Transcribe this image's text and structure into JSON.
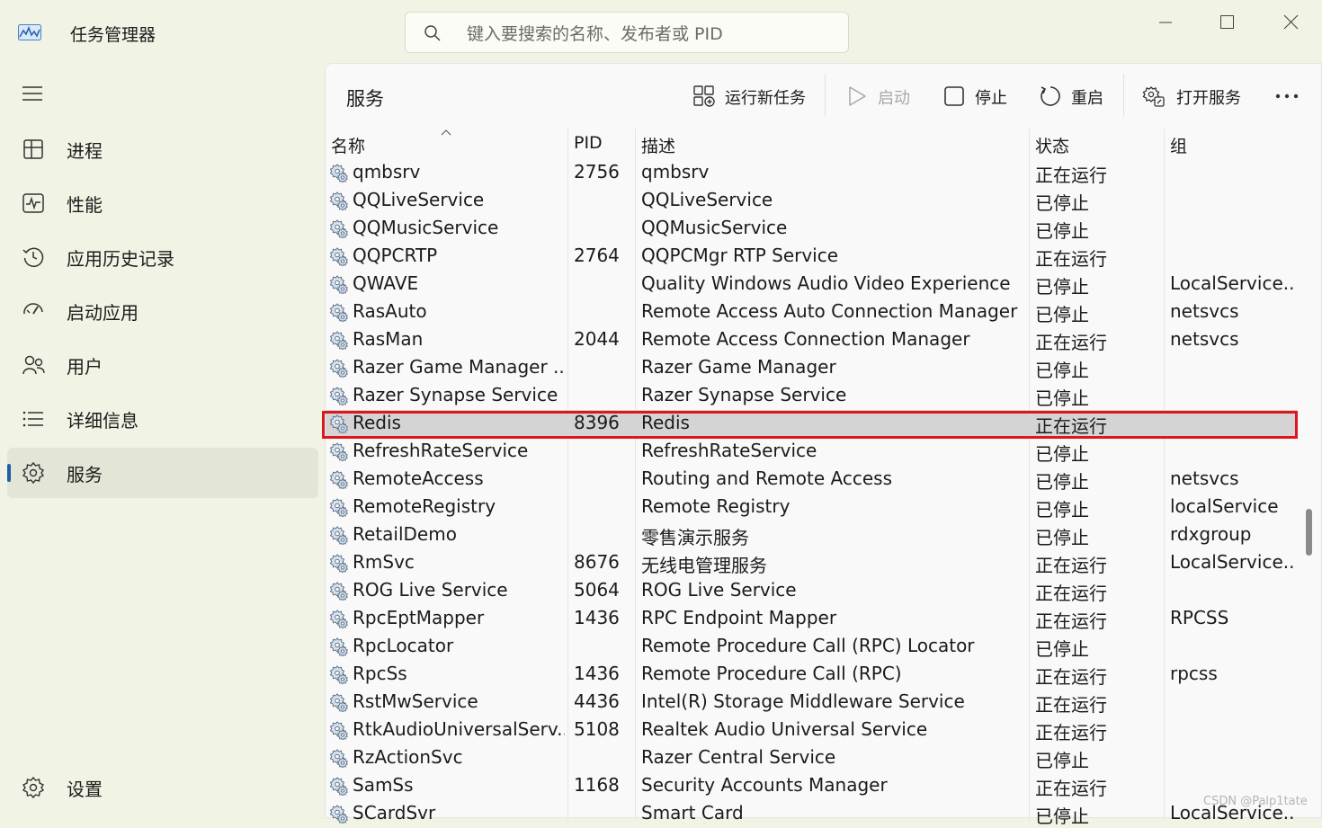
{
  "titlebar": {
    "app_title": "任务管理器",
    "search_placeholder": "键入要搜索的名称、发布者或 PID"
  },
  "sidebar": {
    "items": [
      {
        "label": "进程",
        "icon": "processes-icon"
      },
      {
        "label": "性能",
        "icon": "performance-icon"
      },
      {
        "label": "应用历史记录",
        "icon": "history-icon"
      },
      {
        "label": "启动应用",
        "icon": "startup-icon"
      },
      {
        "label": "用户",
        "icon": "users-icon"
      },
      {
        "label": "详细信息",
        "icon": "details-icon"
      },
      {
        "label": "服务",
        "icon": "services-icon",
        "active": true
      }
    ],
    "settings_label": "设置"
  },
  "toolbar": {
    "page_title": "服务",
    "run_new_task": "运行新任务",
    "start": "启动",
    "stop": "停止",
    "restart": "重启",
    "open_services": "打开服务",
    "more": "..."
  },
  "table": {
    "columns": [
      "名称",
      "PID",
      "描述",
      "状态",
      "组"
    ],
    "rows": [
      {
        "name": "qmbsrv",
        "pid": "2756",
        "desc": "qmbsrv",
        "status": "正在运行",
        "group": ""
      },
      {
        "name": "QQLiveService",
        "pid": "",
        "desc": "QQLiveService",
        "status": "已停止",
        "group": ""
      },
      {
        "name": "QQMusicService",
        "pid": "",
        "desc": "QQMusicService",
        "status": "已停止",
        "group": ""
      },
      {
        "name": "QQPCRTP",
        "pid": "2764",
        "desc": "QQPCMgr RTP Service",
        "status": "正在运行",
        "group": ""
      },
      {
        "name": "QWAVE",
        "pid": "",
        "desc": "Quality Windows Audio Video Experience",
        "status": "已停止",
        "group": "LocalService..."
      },
      {
        "name": "RasAuto",
        "pid": "",
        "desc": "Remote Access Auto Connection Manager",
        "status": "已停止",
        "group": "netsvcs"
      },
      {
        "name": "RasMan",
        "pid": "2044",
        "desc": "Remote Access Connection Manager",
        "status": "正在运行",
        "group": "netsvcs"
      },
      {
        "name": "Razer Game Manager ...",
        "pid": "",
        "desc": "Razer Game Manager",
        "status": "已停止",
        "group": ""
      },
      {
        "name": "Razer Synapse Service",
        "pid": "",
        "desc": "Razer Synapse Service",
        "status": "已停止",
        "group": ""
      },
      {
        "name": "Redis",
        "pid": "8396",
        "desc": "Redis",
        "status": "正在运行",
        "group": "",
        "selected": true
      },
      {
        "name": "RefreshRateService",
        "pid": "",
        "desc": "RefreshRateService",
        "status": "已停止",
        "group": ""
      },
      {
        "name": "RemoteAccess",
        "pid": "",
        "desc": "Routing and Remote Access",
        "status": "已停止",
        "group": "netsvcs"
      },
      {
        "name": "RemoteRegistry",
        "pid": "",
        "desc": "Remote Registry",
        "status": "已停止",
        "group": "localService"
      },
      {
        "name": "RetailDemo",
        "pid": "",
        "desc": "零售演示服务",
        "status": "已停止",
        "group": "rdxgroup"
      },
      {
        "name": "RmSvc",
        "pid": "8676",
        "desc": "无线电管理服务",
        "status": "正在运行",
        "group": "LocalService..."
      },
      {
        "name": "ROG Live Service",
        "pid": "5064",
        "desc": "ROG Live Service",
        "status": "正在运行",
        "group": ""
      },
      {
        "name": "RpcEptMapper",
        "pid": "1436",
        "desc": "RPC Endpoint Mapper",
        "status": "正在运行",
        "group": "RPCSS"
      },
      {
        "name": "RpcLocator",
        "pid": "",
        "desc": "Remote Procedure Call (RPC) Locator",
        "status": "已停止",
        "group": ""
      },
      {
        "name": "RpcSs",
        "pid": "1436",
        "desc": "Remote Procedure Call (RPC)",
        "status": "正在运行",
        "group": "rpcss"
      },
      {
        "name": "RstMwService",
        "pid": "4436",
        "desc": "Intel(R) Storage Middleware Service",
        "status": "正在运行",
        "group": ""
      },
      {
        "name": "RtkAudioUniversalServ...",
        "pid": "5108",
        "desc": "Realtek Audio Universal Service",
        "status": "正在运行",
        "group": ""
      },
      {
        "name": "RzActionSvc",
        "pid": "",
        "desc": "Razer Central Service",
        "status": "已停止",
        "group": ""
      },
      {
        "name": "SamSs",
        "pid": "1168",
        "desc": "Security Accounts Manager",
        "status": "正在运行",
        "group": ""
      },
      {
        "name": "SCardSvr",
        "pid": "",
        "desc": "Smart Card",
        "status": "已停止",
        "group": "LocalService..."
      }
    ]
  },
  "watermark": "CSDN @Palp1tate",
  "colors": {
    "highlight": "#e0161e",
    "accent": "#1f5fa8",
    "selected_row": "#d4d4d4"
  }
}
